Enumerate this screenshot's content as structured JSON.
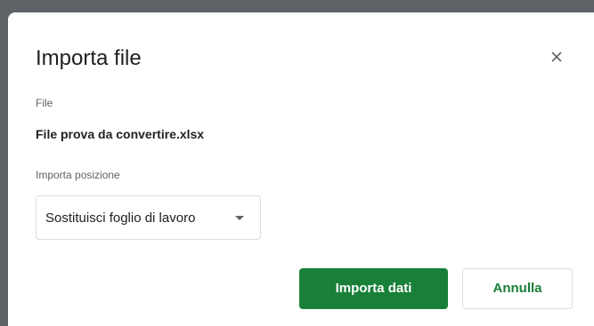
{
  "dialog": {
    "title": "Importa file",
    "close_icon": "close-icon",
    "file_label": "File",
    "file_name": "File prova da convertire.xlsx",
    "position_label": "Importa posizione",
    "position_select": {
      "selected": "Sostituisci foglio di lavoro",
      "caret_icon": "caret-down-icon"
    },
    "buttons": {
      "import_label": "Importa dati",
      "cancel_label": "Annulla"
    }
  },
  "colors": {
    "accent": "#188038",
    "text": "#202124",
    "muted": "#5f6368",
    "border": "#dadce0",
    "backdrop": "#5f6368"
  }
}
